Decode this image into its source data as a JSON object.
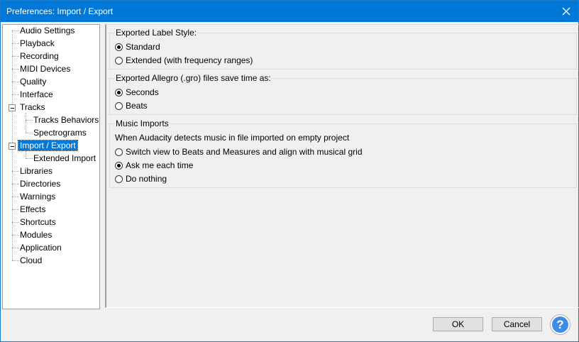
{
  "window": {
    "title": "Preferences: Import / Export",
    "accent_color": "#0078d7",
    "close_icon": "close-icon"
  },
  "sidebar": {
    "items": [
      {
        "label": "Audio Settings"
      },
      {
        "label": "Playback"
      },
      {
        "label": "Recording"
      },
      {
        "label": "MIDI Devices"
      },
      {
        "label": "Quality"
      },
      {
        "label": "Interface"
      },
      {
        "label": "Tracks"
      },
      {
        "label": "Tracks Behaviors"
      },
      {
        "label": "Spectrograms"
      },
      {
        "label": "Import / Export"
      },
      {
        "label": "Extended Import"
      },
      {
        "label": "Libraries"
      },
      {
        "label": "Directories"
      },
      {
        "label": "Warnings"
      },
      {
        "label": "Effects"
      },
      {
        "label": "Shortcuts"
      },
      {
        "label": "Modules"
      },
      {
        "label": "Application"
      },
      {
        "label": "Cloud"
      }
    ],
    "selected": "Import / Export"
  },
  "main": {
    "label_style": {
      "title": "Exported Label Style:",
      "options": [
        {
          "label": "Standard",
          "checked": true
        },
        {
          "label": "Extended (with frequency ranges)",
          "checked": false
        }
      ]
    },
    "allegro": {
      "title": "Exported Allegro (.gro) files save time as:",
      "options": [
        {
          "label": "Seconds",
          "checked": true
        },
        {
          "label": "Beats",
          "checked": false
        }
      ]
    },
    "music_imports": {
      "title": "Music Imports",
      "description": "When Audacity detects music in file imported on empty project",
      "options": [
        {
          "label": "Switch view to Beats and Measures and align with musical grid",
          "checked": false
        },
        {
          "label": "Ask me each time",
          "checked": true
        },
        {
          "label": "Do nothing",
          "checked": false
        }
      ]
    }
  },
  "footer": {
    "ok_label": "OK",
    "cancel_label": "Cancel",
    "help_label": "?",
    "help_icon": "help-icon"
  }
}
